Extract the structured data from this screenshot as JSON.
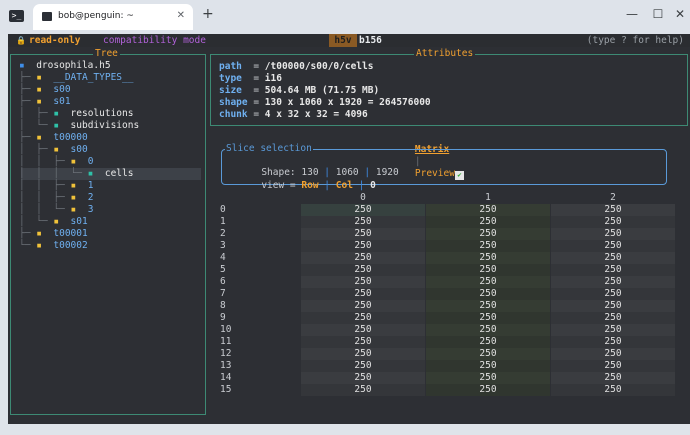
{
  "browser": {
    "tab_title": "bob@penguin: ~",
    "tab_close": "✕",
    "new_tab": "+",
    "minimize": "—",
    "maximize": "☐",
    "close": "✕"
  },
  "topbar": {
    "lock_icon": "🔒",
    "read_only": "read-only",
    "compat": "compatibility mode",
    "app_tab": "h5v",
    "file_tab": "b156",
    "help": "(type ? for help)"
  },
  "tree": {
    "title": "Tree",
    "rows": [
      {
        "prefix": "",
        "icon": "▪",
        "label": "drosophila.h5",
        "indent": "  "
      },
      {
        "prefix": "├─",
        "icon": "▪",
        "label": "__DATA_TYPES__"
      },
      {
        "prefix": "├─",
        "icon": "▪",
        "label": "s00"
      },
      {
        "prefix": "├─",
        "icon": "▪",
        "label": "s01"
      },
      {
        "prefix": "│  ├─",
        "icon": "▪",
        "label": "resolutions"
      },
      {
        "prefix": "│  └─",
        "icon": "▪",
        "label": "subdivisions"
      },
      {
        "prefix": "├─",
        "icon": "▪",
        "label": "t00000"
      },
      {
        "prefix": "│  ├─",
        "icon": "▪",
        "label": "s00"
      },
      {
        "prefix": "│  │  ├─",
        "icon": "▪",
        "label": "0"
      },
      {
        "prefix": "│  │  │  └─",
        "icon": "▪",
        "label": "cells"
      },
      {
        "prefix": "│  │  ├─",
        "icon": "▪",
        "label": "1"
      },
      {
        "prefix": "│  │  ├─",
        "icon": "▪",
        "label": "2"
      },
      {
        "prefix": "│  │  └─",
        "icon": "▪",
        "label": "3"
      },
      {
        "prefix": "│  └─",
        "icon": "▪",
        "label": "s01"
      },
      {
        "prefix": "├─",
        "icon": "▪",
        "label": "t00001"
      },
      {
        "prefix": "└─",
        "icon": "▪",
        "label": "t00002"
      }
    ]
  },
  "attributes": {
    "title": "Attributes",
    "rows": [
      {
        "key": "path ",
        "eq": " = ",
        "value": "/t00000/s00/0/cells"
      },
      {
        "key": "type ",
        "eq": " = ",
        "value": "i16"
      },
      {
        "key": "size ",
        "eq": " = ",
        "value": "504.64 MB (71.75 MB)"
      },
      {
        "key": "shape",
        "eq": " = ",
        "value": "130 x 1060 x 1920 = 264576000"
      },
      {
        "key": "chunk",
        "eq": " = ",
        "value": "4 x 32 x 32 = 4096"
      }
    ]
  },
  "view_tabs": {
    "matrix": "Matrix",
    "sep": "|",
    "preview": "Preview"
  },
  "slice": {
    "title": "Slice selection",
    "shape_label": "Shape:",
    "shape_dims": [
      "130",
      "1060",
      "1920"
    ],
    "view_label": "view =",
    "row": "Row",
    "col": "Col",
    "index": "0",
    "sep": "|"
  },
  "matrix": {
    "columns": [
      "0",
      "1",
      "2"
    ],
    "rows": [
      "0",
      "1",
      "2",
      "3",
      "4",
      "5",
      "6",
      "7",
      "8",
      "9",
      "10",
      "11",
      "12",
      "13",
      "14",
      "15"
    ],
    "value": "250",
    "colors": {
      "col_a": "#3a3c40",
      "col_b": "#353c33",
      "col_a_alt": "#34363a",
      "col_b_alt": "#30362f",
      "first_cell": "#36413f"
    }
  }
}
